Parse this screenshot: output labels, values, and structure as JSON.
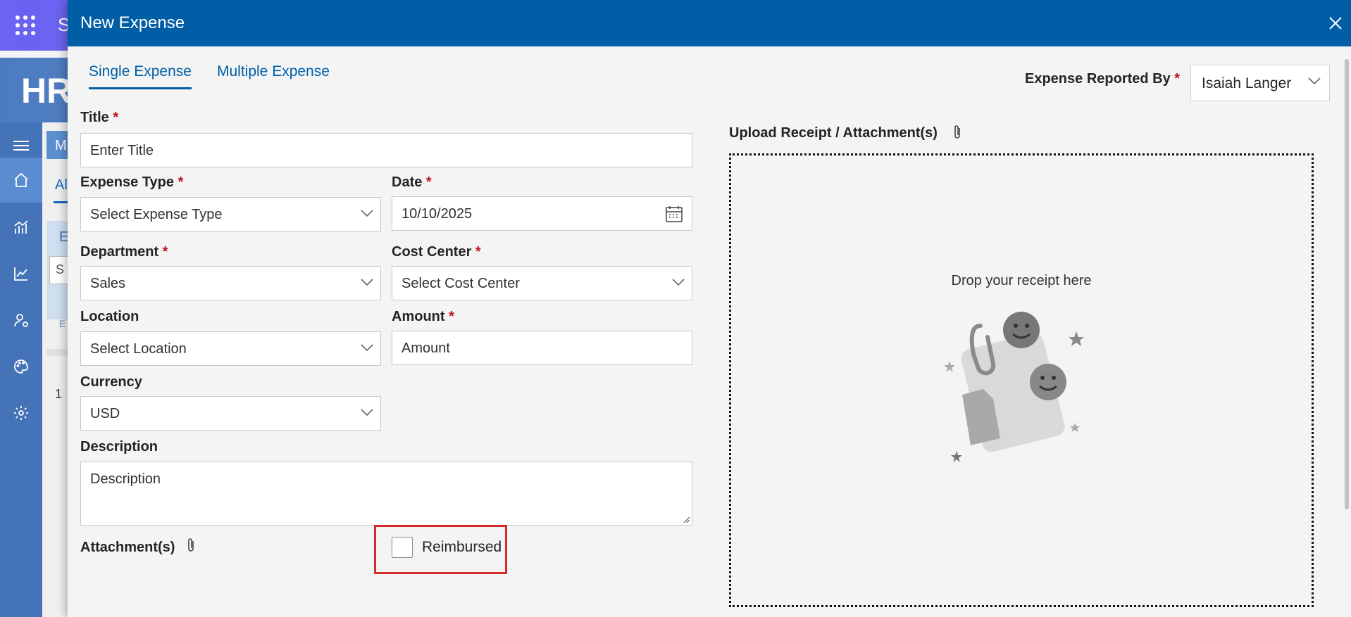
{
  "background_app": {
    "app_letter": "S",
    "hero_text": "HR",
    "panel_letter": "M",
    "tab_letter": "Al",
    "card_letter": "E",
    "search_letter": "S",
    "small_letter": "E",
    "page_number": "1"
  },
  "dialog": {
    "title": "New Expense",
    "tabs": [
      {
        "label": "Single Expense",
        "active": true
      },
      {
        "label": "Multiple Expense",
        "active": false
      }
    ],
    "reported_by": {
      "label": "Expense Reported By",
      "required": "*",
      "value": "Isaiah Langer"
    },
    "fields": {
      "title": {
        "label": "Title",
        "required": "*",
        "placeholder": "Enter Title"
      },
      "expense_type": {
        "label": "Expense Type",
        "required": "*",
        "value": "Select Expense Type"
      },
      "date": {
        "label": "Date",
        "required": "*",
        "value": "10/10/2025"
      },
      "department": {
        "label": "Department",
        "required": "*",
        "value": "Sales"
      },
      "cost_center": {
        "label": "Cost Center",
        "required": "*",
        "value": "Select Cost Center"
      },
      "location": {
        "label": "Location",
        "value": "Select Location"
      },
      "amount": {
        "label": "Amount",
        "required": "*",
        "placeholder": "Amount"
      },
      "currency": {
        "label": "Currency",
        "value": "USD"
      },
      "description": {
        "label": "Description",
        "placeholder": "Description"
      }
    },
    "attachments_label": "Attachment(s)",
    "reimbursed": {
      "label": "Reimbursed",
      "checked": false
    },
    "upload": {
      "label": "Upload Receipt / Attachment(s)",
      "drop_text": "Drop your receipt here"
    }
  },
  "colors": {
    "header": "#005ea6",
    "accent": "#005ea6",
    "required": "#c50f1f",
    "highlight": "#d42a2a",
    "sidebar": "#4474b7",
    "topbar": "#5b6cf0"
  },
  "icons": [
    "waffle-icon",
    "close-icon",
    "chevron-down-icon",
    "calendar-icon",
    "paperclip-icon",
    "resize-handle-icon",
    "home-icon",
    "analytics-icon",
    "chart-icon",
    "user-settings-icon",
    "palette-icon",
    "gear-icon",
    "receipt-illustration"
  ]
}
